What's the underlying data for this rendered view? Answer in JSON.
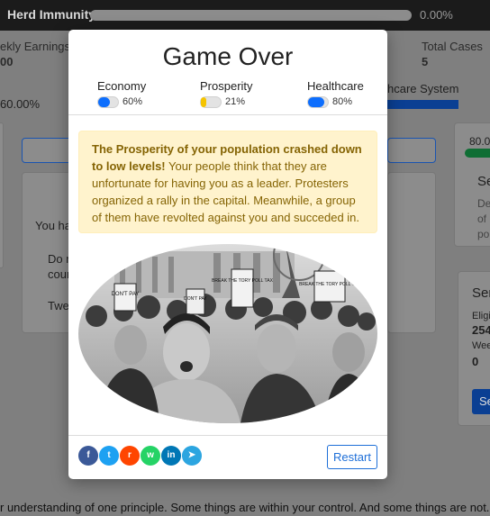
{
  "background": {
    "topbar": {
      "title": "Herd Immunity",
      "percent": "0.00%"
    },
    "stats": {
      "weekly_earnings_label": "ekly Earnings",
      "weekly_earnings_value": "00",
      "total_cases_label": "Total Cases",
      "total_cases_value": "5",
      "left_percent": "60.00%",
      "healthcare_system": "hcare System",
      "right_value": "80.0"
    },
    "card_texts": {
      "you_have": "You hav",
      "do_not": "Do n",
      "could": "cour",
      "tweet": "Twee",
      "se_1": "Se",
      "de": "De",
      "of": "of",
      "po": "po",
      "ser": "Ser",
      "elig": "Eligi",
      "v254": "254",
      "week": "Wee",
      "zero": "0",
      "btn_se": "Se"
    },
    "footer": "r understanding of one principle. Some things are within your control. And some things are not."
  },
  "modal": {
    "title": "Game Over",
    "metrics": [
      {
        "label": "Economy",
        "value": "60%",
        "fraction": 0.6,
        "color": "#0d6efd"
      },
      {
        "label": "Prosperity",
        "value": "21%",
        "fraction": 0.21,
        "color": "#f5c400"
      },
      {
        "label": "Healthcare",
        "value": "80%",
        "fraction": 0.8,
        "color": "#0d6efd"
      }
    ],
    "alert_bold": "The Prosperity of your population crashed down to low levels!",
    "alert_text": " Your people think that they are unfortunate for having you as a leader. Protesters organized a rally in the capital. Meanwhile, a group of them have revolted against you and succeded in.",
    "protest_signs": [
      "DON'T PAY",
      "BREAK THE TORY POLL TAX",
      "DON'T PAY",
      "BREAK THE TORY POLL TAX"
    ],
    "share_buttons": [
      {
        "name": "facebook-icon",
        "glyph": "f",
        "color": "#3b5998"
      },
      {
        "name": "twitter-icon",
        "glyph": "t",
        "color": "#1da1f2"
      },
      {
        "name": "reddit-icon",
        "glyph": "r",
        "color": "#ff4500"
      },
      {
        "name": "whatsapp-icon",
        "glyph": "w",
        "color": "#25d366"
      },
      {
        "name": "linkedin-icon",
        "glyph": "in",
        "color": "#0077b5"
      },
      {
        "name": "telegram-icon",
        "glyph": "➤",
        "color": "#2ca5e0"
      }
    ],
    "restart_label": "Restart"
  }
}
